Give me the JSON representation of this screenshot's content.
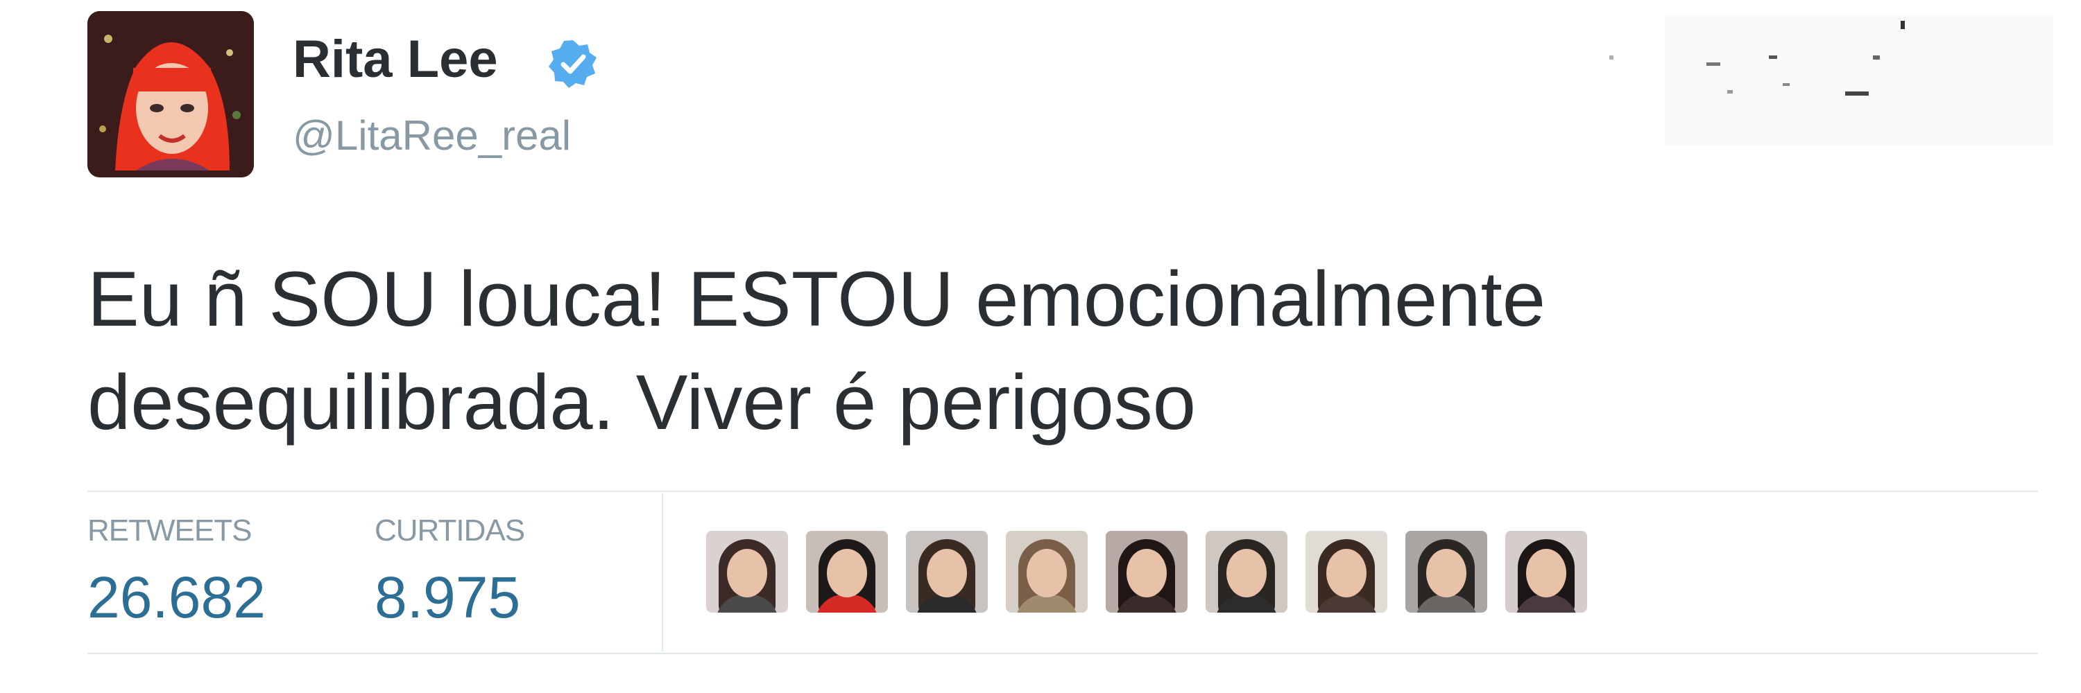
{
  "user": {
    "display_name": "Rita Lee",
    "handle": "@LitaRee_real",
    "verified": true,
    "avatar_icon": "redhead-cartoon-avatar",
    "verified_icon": "verified-badge-icon"
  },
  "tweet": {
    "lines": [
      "Eu ñ SOU louca! ESTOU emocionalmente",
      "desequilibrada. Viver é perigoso"
    ]
  },
  "stats": {
    "retweets_label": "RETWEETS",
    "retweets_value": "26.682",
    "likes_label": "CURTIDAS",
    "likes_value": "8.975"
  },
  "likers": [
    {
      "bg": "#d9d2d0",
      "hair": "#3b2a25",
      "body": "#4a4a4a"
    },
    {
      "bg": "#c9bdb8",
      "hair": "#1e1a1a",
      "body": "#d42a23"
    },
    {
      "bg": "#c8c3be",
      "hair": "#3a2b22",
      "body": "#2a2a2a"
    },
    {
      "bg": "#d6cfc5",
      "hair": "#7a5e48",
      "body": "#a08a6e"
    },
    {
      "bg": "#b7a9a6",
      "hair": "#1f1615",
      "body": "#3a2a2a"
    },
    {
      "bg": "#cfc8c2",
      "hair": "#2b2522",
      "body": "#2c2c2c"
    },
    {
      "bg": "#e1dbd6",
      "hair": "#3a2a22",
      "body": "#4a3a33"
    },
    {
      "bg": "#a9a5a2",
      "hair": "#2a2624",
      "body": "#6a6664"
    },
    {
      "bg": "#d4cdca",
      "hair": "#1c1716",
      "body": "#4a3a40"
    }
  ],
  "colors": {
    "accent": "#2c6e94",
    "muted": "#8899a6",
    "text": "#292f33",
    "verified": "#55acee"
  }
}
